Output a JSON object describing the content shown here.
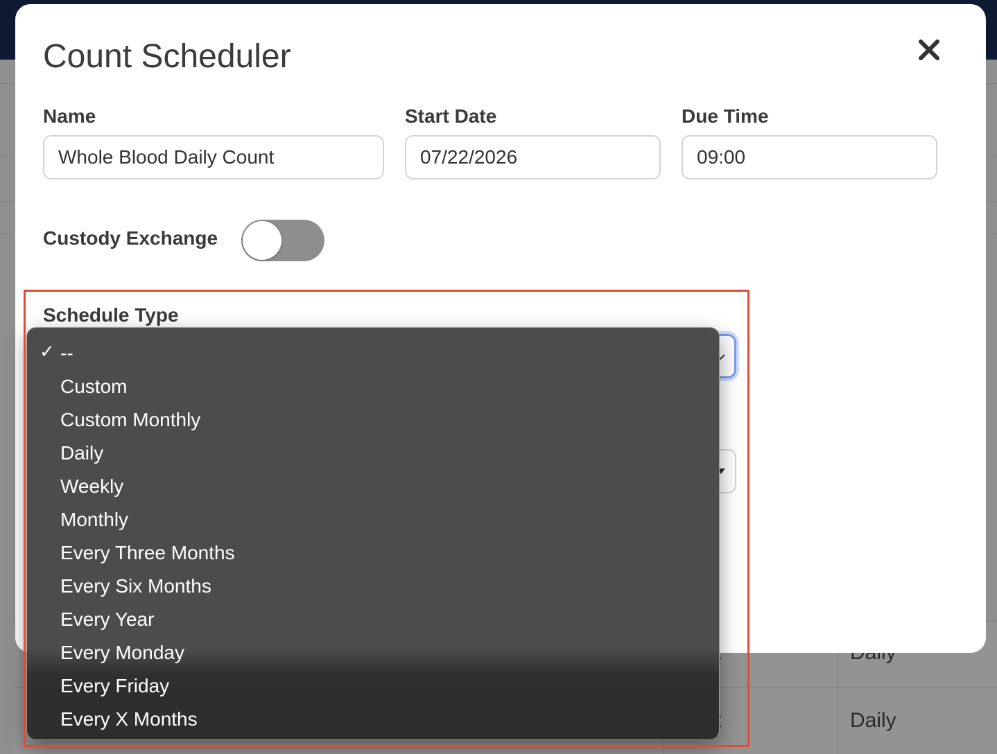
{
  "modal": {
    "title": "Count Scheduler",
    "close_icon": "close-icon"
  },
  "fields": {
    "name": {
      "label": "Name",
      "value": "Whole Blood Daily Count"
    },
    "start_date": {
      "label": "Start Date",
      "value": "07/22/2026"
    },
    "due_time": {
      "label": "Due Time",
      "value": "09:00"
    },
    "custody_exchange": {
      "label": "Custody Exchange",
      "enabled": false
    },
    "schedule_type": {
      "label": "Schedule Type",
      "selected": "--"
    }
  },
  "dropdown": {
    "check_mark": "✓",
    "options": [
      "--",
      "Custom",
      "Custom Monthly",
      "Daily",
      "Weekly",
      "Monthly",
      "Every Three Months",
      "Every Six Months",
      "Every Year",
      "Every Monday",
      "Every Friday",
      "Every X Months"
    ]
  },
  "background": {
    "cells": [
      "Daily",
      "Daily",
      "t",
      "t"
    ]
  },
  "colors": {
    "highlight": "#e04b3a",
    "topbar": "#0e1a33",
    "focus_ring": "#7b9cf0"
  }
}
